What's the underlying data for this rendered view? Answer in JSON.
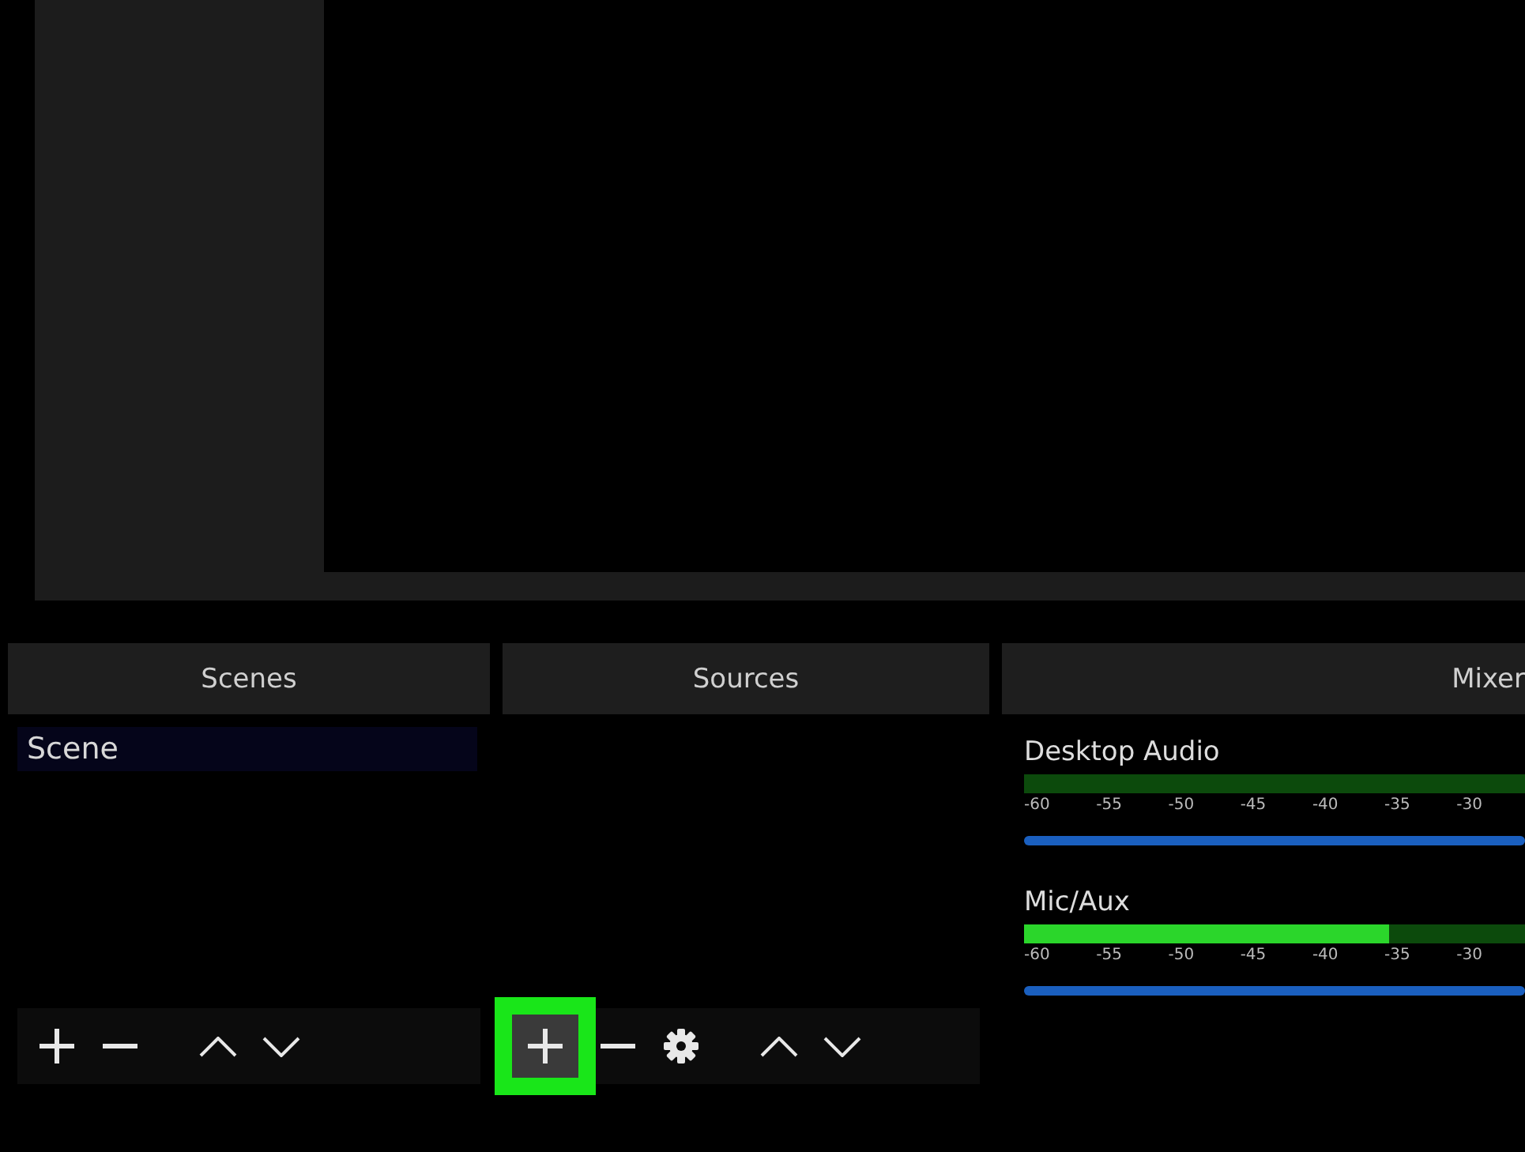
{
  "scenes": {
    "title": "Scenes",
    "items": [
      {
        "label": "Scene",
        "selected": true
      }
    ],
    "toolbar": [
      {
        "kind": "add",
        "highlighted": false
      },
      {
        "kind": "remove",
        "highlighted": false
      },
      {
        "kind": "up",
        "highlighted": false
      },
      {
        "kind": "down",
        "highlighted": false
      }
    ]
  },
  "sources": {
    "title": "Sources",
    "toolbar": [
      {
        "kind": "add",
        "highlighted": true
      },
      {
        "kind": "remove",
        "highlighted": false
      },
      {
        "kind": "settings",
        "highlighted": false
      },
      {
        "kind": "up",
        "highlighted": false
      },
      {
        "kind": "down",
        "highlighted": false
      }
    ]
  },
  "mixer": {
    "title": "Mixer",
    "channels": [
      {
        "name": "Desktop Audio",
        "volume": {
          "level": 1
        },
        "ticks": [
          "-60",
          "-55",
          "-50",
          "-45",
          "-40",
          "-35",
          "-30"
        ]
      },
      {
        "name": "Mic/Aux",
        "level": 0.73,
        "volume": {
          "level": 1
        },
        "ticks": [
          "-60",
          "-55",
          "-50",
          "-45",
          "-40",
          "-35",
          "-30"
        ]
      }
    ]
  }
}
